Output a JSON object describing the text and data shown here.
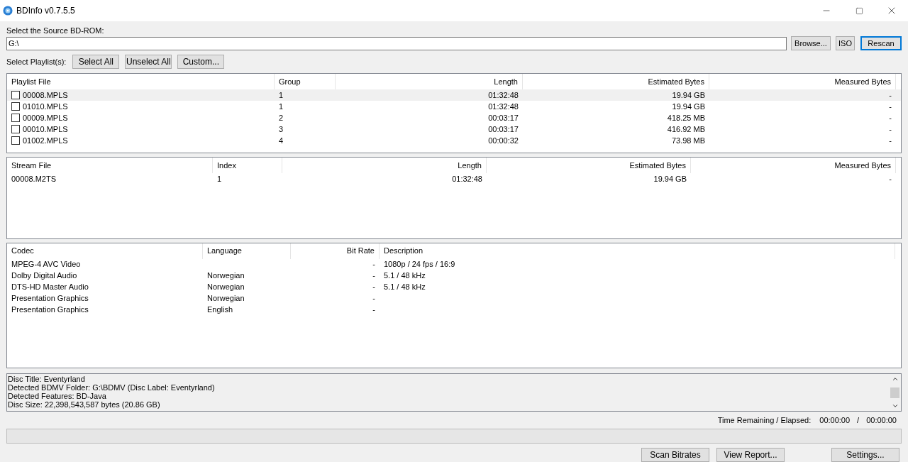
{
  "window": {
    "title": "BDInfo v0.7.5.5"
  },
  "source": {
    "label": "Select the Source BD-ROM:",
    "value": "G:\\",
    "buttons": [
      {
        "label": "Browse...",
        "focused": false
      },
      {
        "label": "ISO",
        "focused": false
      },
      {
        "label": "Rescan",
        "focused": true
      }
    ]
  },
  "playlist_select": {
    "label": "Select Playlist(s):",
    "buttons": [
      "Select All",
      "Unselect All",
      "Custom..."
    ]
  },
  "playlists": {
    "columns": [
      "Playlist File",
      "Group",
      "Length",
      "Estimated Bytes",
      "Measured Bytes"
    ],
    "rows": [
      {
        "cells": [
          "00008.MPLS",
          "1",
          "01:32:48",
          "19.94 GB",
          "-"
        ],
        "checked": false,
        "selected": true
      },
      {
        "cells": [
          "01010.MPLS",
          "1",
          "01:32:48",
          "19.94 GB",
          "-"
        ],
        "checked": false,
        "selected": false
      },
      {
        "cells": [
          "00009.MPLS",
          "2",
          "00:03:17",
          "418.25 MB",
          "-"
        ],
        "checked": false,
        "selected": false
      },
      {
        "cells": [
          "00010.MPLS",
          "3",
          "00:03:17",
          "416.92 MB",
          "-"
        ],
        "checked": false,
        "selected": false
      },
      {
        "cells": [
          "01002.MPLS",
          "4",
          "00:00:32",
          "73.98 MB",
          "-"
        ],
        "checked": false,
        "selected": false
      }
    ]
  },
  "streams": {
    "columns": [
      "Stream File",
      "Index",
      "Length",
      "Estimated Bytes",
      "Measured Bytes"
    ],
    "rows": [
      {
        "cells": [
          "00008.M2TS",
          "1",
          "01:32:48",
          "19.94 GB",
          "-"
        ]
      }
    ]
  },
  "codecs": {
    "columns": [
      "Codec",
      "Language",
      "Bit Rate",
      "Description"
    ],
    "rows": [
      {
        "cells": [
          "MPEG-4 AVC Video",
          "",
          "-",
          "1080p / 24 fps / 16:9"
        ]
      },
      {
        "cells": [
          "Dolby Digital Audio",
          "Norwegian",
          "-",
          "5.1 / 48 kHz"
        ]
      },
      {
        "cells": [
          "DTS-HD Master Audio",
          "Norwegian",
          "-",
          "5.1 / 48 kHz"
        ]
      },
      {
        "cells": [
          "Presentation Graphics",
          "Norwegian",
          "-",
          ""
        ]
      },
      {
        "cells": [
          "Presentation Graphics",
          "English",
          "-",
          ""
        ]
      }
    ]
  },
  "info": [
    "Disc Title: Eventyrland",
    "Detected BDMV Folder: G:\\BDMV (Disc Label: Eventyrland)",
    "Detected Features: BD-Java",
    "Disc Size: 22,398,543,587 bytes (20.86 GB)"
  ],
  "time": {
    "label": "Time Remaining / Elapsed:",
    "remaining": "00:00:00",
    "separator": "/",
    "elapsed": "00:00:00"
  },
  "progress": {
    "level": 0
  },
  "bottom_buttons": [
    "Scan Bitrates",
    "View Report...",
    "Settings..."
  ]
}
